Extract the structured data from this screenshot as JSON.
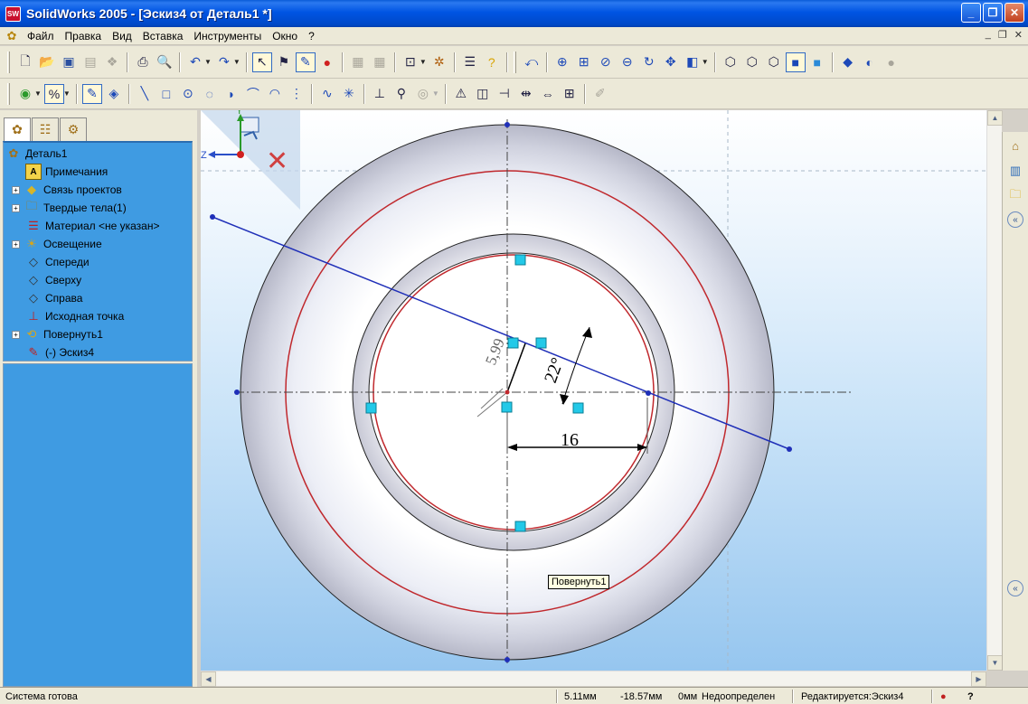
{
  "window": {
    "title": "SolidWorks 2005 - [Эскиз4 от Деталь1 *]",
    "app_icon_label": "SW",
    "controls": [
      "_",
      "❐",
      "✕"
    ]
  },
  "menu": {
    "items": [
      "Файл",
      "Правка",
      "Вид",
      "Вставка",
      "Инструменты",
      "Окно",
      "?"
    ],
    "mdi_controls": [
      "_",
      "❐",
      "✕"
    ]
  },
  "feature_tree": {
    "tabs": [
      "feature-manager",
      "property-manager",
      "configuration-manager"
    ],
    "items": [
      {
        "label": "Деталь1",
        "icon": "part-icon",
        "expander": ""
      },
      {
        "label": "Примечания",
        "icon": "annotations-icon",
        "expander": ""
      },
      {
        "label": "Связь проектов",
        "icon": "design-binder-icon",
        "expander": "+"
      },
      {
        "label": "Твердые тела(1)",
        "icon": "solid-bodies-icon",
        "expander": "+"
      },
      {
        "label": "Материал <не указан>",
        "icon": "material-icon",
        "expander": ""
      },
      {
        "label": "Освещение",
        "icon": "lighting-icon",
        "expander": "+"
      },
      {
        "label": "Спереди",
        "icon": "plane-icon",
        "expander": ""
      },
      {
        "label": "Сверху",
        "icon": "plane-icon",
        "expander": ""
      },
      {
        "label": "Справа",
        "icon": "plane-icon",
        "expander": ""
      },
      {
        "label": "Исходная точка",
        "icon": "origin-icon",
        "expander": ""
      },
      {
        "label": "Повернуть1",
        "icon": "revolve-icon",
        "expander": "+"
      },
      {
        "label": "(-) Эскиз4",
        "icon": "sketch-icon",
        "expander": ""
      }
    ]
  },
  "viewport": {
    "dimension_radius": "5,99",
    "dimension_angle": "22°",
    "dimension_length": "16",
    "tooltip": "Повернуть1",
    "triad_labels": {
      "y": "Y",
      "z": "Z"
    }
  },
  "status": {
    "message": "Система готова",
    "x_coord": "5.11мм",
    "y_coord": "-18.57мм",
    "z_coord": "0мм",
    "sketch_state": "Недоопределен",
    "editing": "Редактируется:Эскиз4",
    "help_symbol": "?"
  },
  "colors": {
    "sketch_line": "#1f2fb8",
    "profile_circle": "#c0282d",
    "selection_handle": "#23c9e8",
    "tree_background": "#3f9be2",
    "titlebar": "#0054e3"
  }
}
